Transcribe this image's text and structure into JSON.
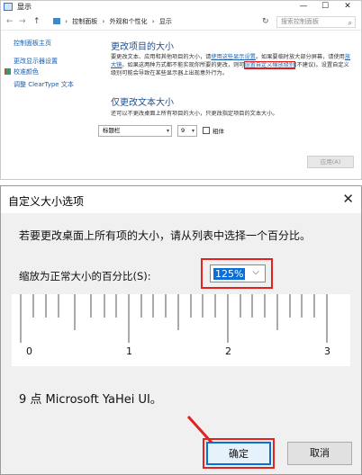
{
  "window": {
    "title": "显示",
    "controls": {
      "min": "—",
      "max": "☐",
      "close": "✕"
    },
    "nav": {
      "back": "←",
      "forward": "→",
      "up": "↑",
      "refresh": "↻"
    },
    "breadcrumb": [
      "控制面板",
      "外观和个性化",
      "显示"
    ],
    "breadcrumb_sep": "›",
    "search_placeholder": "搜索控制面板",
    "sidebar": {
      "items": [
        {
          "label": "控制面板主页"
        },
        {
          "label": "更改显示器设置"
        },
        {
          "label": "校准颜色"
        },
        {
          "label": "调整 ClearType 文本"
        }
      ]
    },
    "main": {
      "heading1": "更改项目的大小",
      "para_part1": "要更改文本、应用和其他项目的大小，请",
      "link1": "使用这些显示设置",
      "para_part2": "。如果要临时放大部分屏幕，请使用",
      "link2": "放大镜",
      "para_part3": "。如果这两种方式都不能实现你所要的更改，则可",
      "link3": "设置自定义缩放级别",
      "para_part4": "(不建议)。设置自定义级别可能会导致在某些显示器上出现意外行为。",
      "heading2": "仅更改文本大小",
      "para2": "还可以不更改桌面上所有项目的大小，只更改指定项目的文本大小。",
      "item_select": "标题栏",
      "size_select": "9",
      "bold_label": "粗体",
      "apply_button": "应用(A)"
    }
  },
  "dialog": {
    "title": "自定义大小选项",
    "close": "✕",
    "instruction": "若要更改桌面上所有项的大小，请从列表中选择一个百分比。",
    "scale_label": "缩放为正常大小的百分比(S):",
    "scale_value": "125%",
    "chevron": "⌵",
    "ruler_numbers": [
      "0",
      "1",
      "2",
      "3"
    ],
    "sample_text": "9 点 Microsoft YaHei UI。",
    "ok_button": "确定",
    "cancel_button": "取消"
  },
  "colors": {
    "link": "#1b5eab",
    "heading": "#1e4f8b",
    "highlight_red": "#e32121",
    "selection_blue": "#0a6fd8"
  }
}
